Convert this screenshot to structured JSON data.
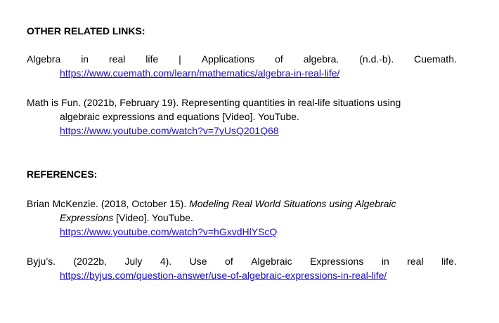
{
  "other_links": {
    "heading": "OTHER RELATED LINKS:",
    "items": [
      {
        "words": [
          "Algebra",
          "in",
          "real",
          "life",
          "|",
          "Applications",
          "of",
          "algebra.",
          "(n.d.-b).",
          "Cuemath."
        ],
        "url": "https://www.cuemath.com/learn/mathematics/algebra-in-real-life/"
      },
      {
        "line1": "Math is Fun. (2021b, February 19). Representing quantities in real-life situations using",
        "line2": "algebraic expressions and equations [Video]. YouTube.",
        "url": "https://www.youtube.com/watch?v=7yUsQ201Q68"
      }
    ]
  },
  "references": {
    "heading": "REFERENCES:",
    "items": [
      {
        "author": "Brian McKenzie. (2018, October 15). ",
        "title_part1": "Modeling Real World Situations using Algebraic",
        "title_part2": "Expressions",
        "suffix": " [Video]. YouTube.",
        "url": "https://www.youtube.com/watch?v=hGxvdHlYScQ"
      },
      {
        "words": [
          "Byju’s.",
          "(2022b,",
          "July",
          "4).",
          "Use",
          "of",
          "Algebraic",
          "Expressions",
          "in",
          "real",
          "life."
        ],
        "url": "https://byjus.com/question-answer/use-of-algebraic-expressions-in-real-life/"
      }
    ]
  }
}
